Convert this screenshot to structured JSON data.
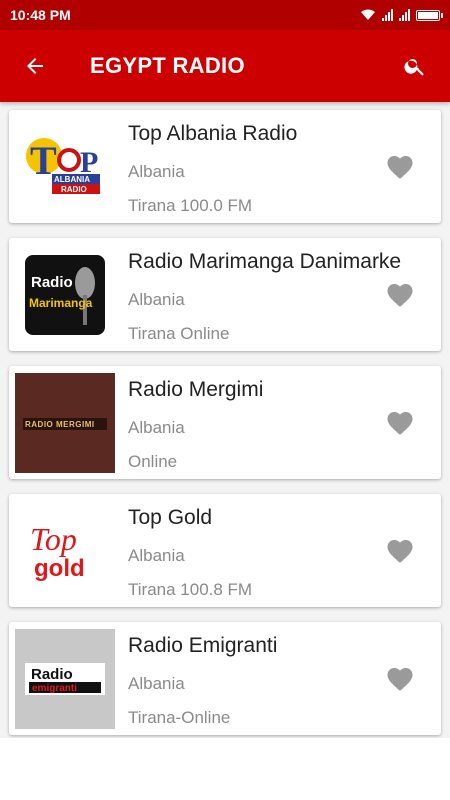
{
  "status_bar": {
    "time": "10:48 PM"
  },
  "app_bar": {
    "title": "EGYPT RADIO",
    "back_icon": "arrow-left-icon",
    "search_icon": "search-icon"
  },
  "colors": {
    "app_bar": "#cc0000",
    "status_bar": "#b00000",
    "favorite": "#9a9a9a"
  },
  "stations": [
    {
      "name": "Top Albania Radio",
      "country": "Albania",
      "detail": " Tirana 100.0 FM",
      "logo": {
        "icon": "top-albania-radio-logo",
        "text": "TOP ALBANIA RADIO"
      }
    },
    {
      "name": "Radio Marimanga Danimarke",
      "country": "Albania",
      "detail": " Tirana Online",
      "logo": {
        "icon": "radio-marimanga-logo",
        "text": "Radio Marimanga"
      }
    },
    {
      "name": "Radio Mergimi",
      "country": "Albania",
      "detail": "Online",
      "logo": {
        "icon": "radio-mergimi-logo",
        "text": "RADIO MERGIMI"
      }
    },
    {
      "name": "Top Gold",
      "country": "Albania",
      "detail": " Tirana 100.8 FM",
      "logo": {
        "icon": "top-gold-logo",
        "text": "Top gold"
      }
    },
    {
      "name": "Radio Emigranti",
      "country": "Albania",
      "detail": " Tirana-Online",
      "logo": {
        "icon": "radio-emigranti-logo",
        "text": "Radio emigranti"
      }
    }
  ]
}
